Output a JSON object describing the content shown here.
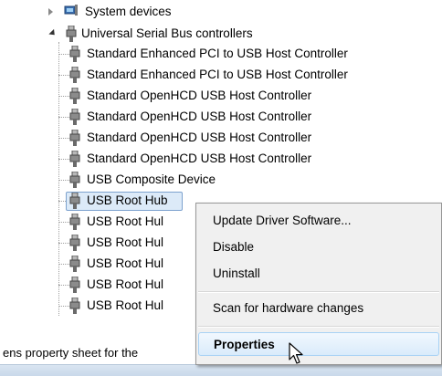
{
  "tree": {
    "system_devices": "System devices",
    "usb_controllers": "Universal Serial Bus controllers",
    "children": [
      "Standard Enhanced PCI to USB Host Controller",
      "Standard Enhanced PCI to USB Host Controller",
      "Standard OpenHCD USB Host Controller",
      "Standard OpenHCD USB Host Controller",
      "Standard OpenHCD USB Host Controller",
      "Standard OpenHCD USB Host Controller",
      "USB Composite Device",
      "USB Root Hub",
      "USB Root Hul",
      "USB Root Hul",
      "USB Root Hul",
      "USB Root Hul",
      "USB Root Hul"
    ],
    "selected_index": 7
  },
  "context_menu": {
    "items": [
      "Update Driver Software...",
      "Disable",
      "Uninstall",
      "Scan for hardware changes",
      "Properties"
    ],
    "default_item": "Properties",
    "hover_item": "Properties"
  },
  "status_bar": {
    "text": "ens property sheet for the"
  },
  "colors": {
    "selection": "#dceaf8",
    "selection_border": "#7da2ce",
    "menu_background": "#f0f0f0",
    "menu_hover": "#d9ebfb"
  },
  "icons": {
    "device_icon": "usb-plug-icon",
    "system_icon": "system-devices-icon"
  }
}
